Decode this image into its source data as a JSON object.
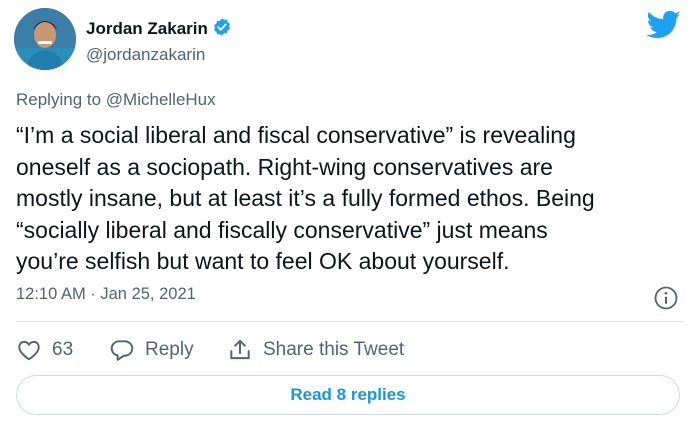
{
  "author": {
    "name": "Jordan Zakarin",
    "handle": "@jordanzakarin",
    "avatar_icon": "avatar-photo",
    "verified_icon": "verified-badge-icon"
  },
  "brand": {
    "logo_icon": "twitter-bird-icon",
    "color": "#1da1f2"
  },
  "reply_context": {
    "prefix": "Replying to",
    "handle": "@MichelleHux"
  },
  "tweet": {
    "lines": [
      "“I’m a social liberal and fiscal conservative” is revealing",
      "oneself as a sociopath. Right-wing conservatives are",
      "mostly insane, but at least it’s a fully formed ethos. Being",
      "“socially liberal and fiscally conservative” just means",
      "you’re selfish but want to feel OK about yourself."
    ]
  },
  "meta": {
    "timestamp": "12:10 AM · Jan 25, 2021",
    "info_icon": "info-icon"
  },
  "actions": {
    "like": {
      "icon": "heart-icon",
      "count": "63"
    },
    "reply": {
      "icon": "reply-bubble-icon",
      "label": "Reply"
    },
    "share": {
      "icon": "share-icon",
      "label": "Share this Tweet"
    }
  },
  "read_replies_label": "Read 8 replies",
  "colors": {
    "link": "#1b95e0",
    "muted": "#536471",
    "text": "#0f1419",
    "divider": "#e1e8ed"
  }
}
